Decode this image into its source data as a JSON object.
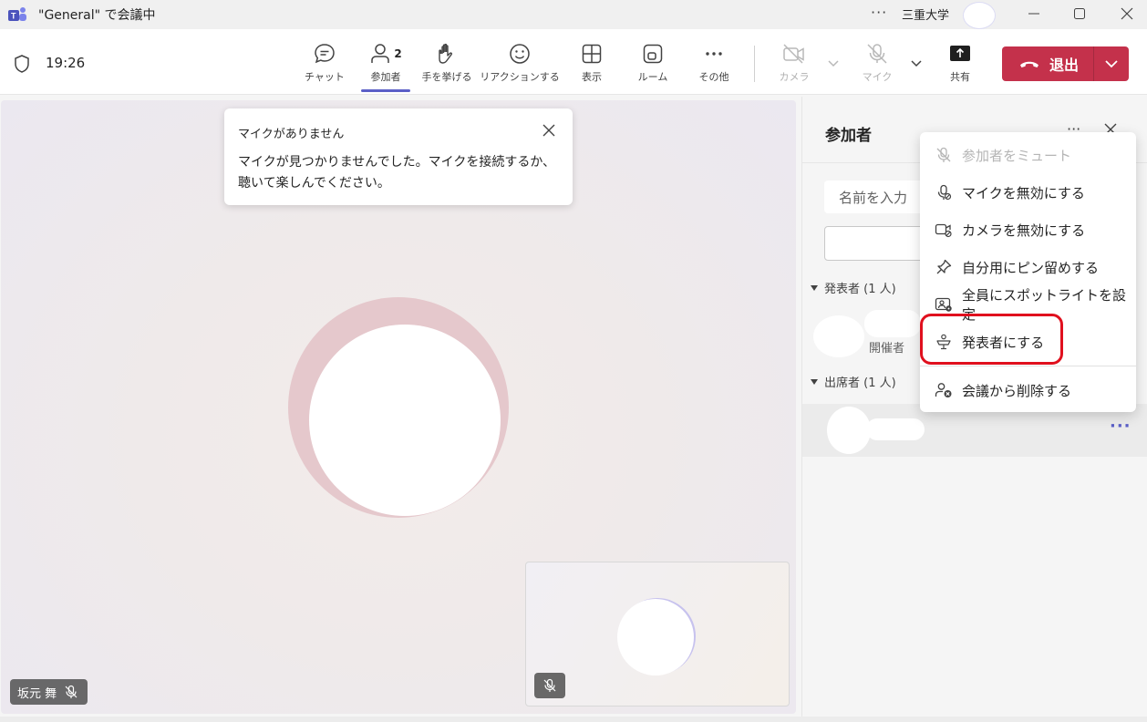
{
  "titlebar": {
    "title": "\"General\" で会議中",
    "org_name": "三重大学",
    "more": "···"
  },
  "toolbar": {
    "time": "19:26",
    "tools": {
      "chat": "チャット",
      "participants": "参加者",
      "participants_count": "2",
      "raise_hand": "手を挙げる",
      "reactions": "リアクションする",
      "view": "表示",
      "rooms": "ルーム",
      "more": "その他",
      "camera": "カメラ",
      "mic": "マイク",
      "share": "共有"
    },
    "leave_label": "退出",
    "leave_color": "#c4314b",
    "accent": "#5b5fc7"
  },
  "toast": {
    "title": "マイクがありません",
    "body": "マイクが見つかりませんでした。マイクを接続するか、聴いて楽しんでください。"
  },
  "stage": {
    "name_badge": "坂元 舞"
  },
  "panel": {
    "title": "参加者",
    "search_placeholder": "名前を入力",
    "presenters_section": "発表者 (1 人)",
    "organizer_role": "開催者",
    "attendees_section": "出席者 (1 人)"
  },
  "menu": {
    "items": [
      {
        "label": "参加者をミュート",
        "icon": "mic-off-icon",
        "disabled": true
      },
      {
        "label": "マイクを無効にする",
        "icon": "mic-disable-icon",
        "disabled": false
      },
      {
        "label": "カメラを無効にする",
        "icon": "camera-disable-icon",
        "disabled": false
      },
      {
        "label": "自分用にピン留めする",
        "icon": "pin-icon",
        "disabled": false
      },
      {
        "label": "全員にスポットライトを設定",
        "icon": "spotlight-icon",
        "disabled": false
      },
      {
        "label": "発表者にする",
        "icon": "presenter-icon",
        "disabled": false
      },
      {
        "label": "会議から削除する",
        "icon": "remove-person-icon",
        "disabled": false
      }
    ]
  }
}
